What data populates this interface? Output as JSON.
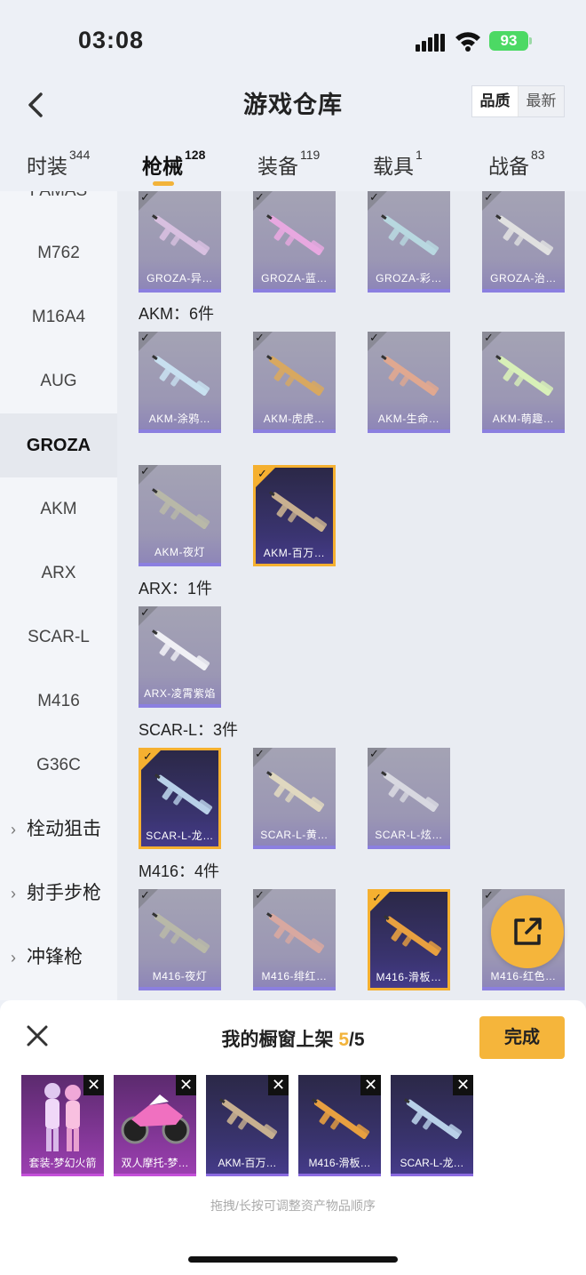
{
  "status_bar": {
    "time": "03:08",
    "battery": "93"
  },
  "header": {
    "title": "游戏仓库",
    "sort_options": [
      "品质",
      "最新"
    ]
  },
  "tabs": [
    {
      "label": "时装",
      "count": "344"
    },
    {
      "label": "枪械",
      "count": "128"
    },
    {
      "label": "装备",
      "count": "119"
    },
    {
      "label": "载具",
      "count": "1"
    },
    {
      "label": "战备",
      "count": "83"
    }
  ],
  "sidebar": {
    "items": [
      "FAMAS",
      "M762",
      "M16A4",
      "AUG",
      "GROZA",
      "AKM",
      "ARX",
      "SCAR-L",
      "M416",
      "G36C"
    ],
    "categories": [
      "栓动狙击",
      "射手步枪",
      "冲锋枪"
    ]
  },
  "sections": {
    "groza": {
      "items": [
        "GROZA-异…",
        "GROZA-蓝…",
        "GROZA-彩…",
        "GROZA-治…"
      ]
    },
    "akm": {
      "title": "AKM：6件",
      "items": [
        "AKM-涂鸦…",
        "AKM-虎虎…",
        "AKM-生命…",
        "AKM-萌趣…",
        "AKM-夜灯",
        "AKM-百万…"
      ]
    },
    "arx": {
      "title": "ARX：1件",
      "items": [
        "ARX-凌霄紫焰"
      ]
    },
    "scar": {
      "title": "SCAR-L：3件",
      "items": [
        "SCAR-L-龙…",
        "SCAR-L-黄…",
        "SCAR-L-炫…"
      ]
    },
    "m416": {
      "title": "M416：4件",
      "items": [
        "M416-夜灯",
        "M416-绯红…",
        "M416-滑板…",
        "M416-红色…"
      ]
    }
  },
  "bottom_panel": {
    "title": "我的橱窗上架",
    "count": "5",
    "total": "/5",
    "done_label": "完成",
    "items": [
      "套装-梦幻火箭",
      "双人摩托-梦…",
      "AKM-百万…",
      "M416-滑板…",
      "SCAR-L-龙…"
    ],
    "hint": "拖拽/长按可调整资产物品顺序"
  },
  "colors": {
    "accent": "#f5b53b",
    "selected_border": "#f5b030",
    "card_purple": "#9b97b4"
  }
}
